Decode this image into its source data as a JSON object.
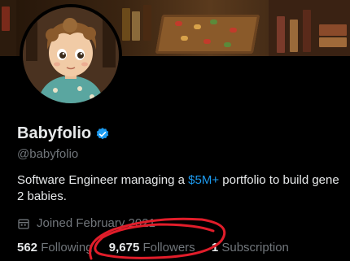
{
  "profile": {
    "name": "Babyfolio",
    "handle": "@babyfolio",
    "bio_pre": "Software Engineer managing a ",
    "bio_link": "$5M+",
    "bio_post": " portfolio to build gene",
    "bio_line2": "2 babies.",
    "joined": "Joined February 2021"
  },
  "stats": {
    "following_count": "562",
    "following_label": "Following",
    "followers_count": "9,675",
    "followers_label": "Followers",
    "subscriptions_count": "1",
    "subscriptions_label": "Subscription"
  },
  "colors": {
    "accent": "#1d9bf0",
    "muted": "#71767b",
    "annotation": "#e11d2a"
  },
  "icons": {
    "verified": "verified-badge-icon",
    "calendar": "calendar-icon"
  }
}
